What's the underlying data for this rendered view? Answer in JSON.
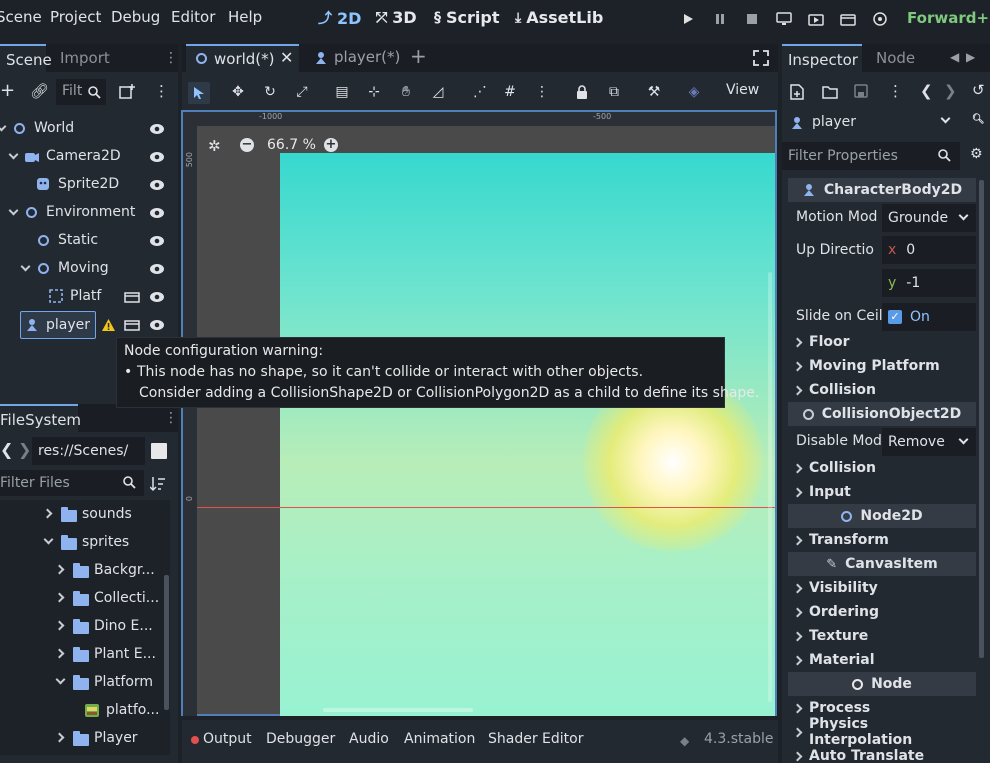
{
  "menu": [
    "Scene",
    "Project",
    "Debug",
    "Editor",
    "Help"
  ],
  "workspaces": [
    "2D",
    "3D",
    "Script",
    "AssetLib"
  ],
  "renderer": "Forward+",
  "scene_dock": {
    "tabs": [
      "Scene",
      "Import"
    ],
    "filter_placeholder": "Filt",
    "tree": [
      {
        "name": "World"
      },
      {
        "name": "Camera2D"
      },
      {
        "name": "Sprite2D"
      },
      {
        "name": "Environment"
      },
      {
        "name": "Static"
      },
      {
        "name": "Moving"
      },
      {
        "name": "Platf"
      },
      {
        "name": "player"
      }
    ]
  },
  "tooltip": {
    "title": "Node configuration warning:",
    "bullet": "•",
    "line1": "This node has no shape, so it can't collide or interact with other objects.",
    "line2": "Consider adding a CollisionShape2D or CollisionPolygon2D as a child to define its shape."
  },
  "filesystem": {
    "tab": "FileSystem",
    "path": "res://Scenes/",
    "filter_placeholder": "Filter Files",
    "items": [
      {
        "name": "sounds"
      },
      {
        "name": "sprites"
      },
      {
        "name": "Backgr..."
      },
      {
        "name": "Collecti..."
      },
      {
        "name": "Dino E..."
      },
      {
        "name": "Plant E..."
      },
      {
        "name": "Platform"
      },
      {
        "name": "platfo..."
      },
      {
        "name": "Player"
      }
    ]
  },
  "editor_tabs": [
    "world(*)",
    "player(*)"
  ],
  "toolbar": {
    "view": "View"
  },
  "viewport": {
    "zoom": "66.7 %",
    "ruler_h": [
      "-1000",
      "-500"
    ],
    "ruler_v": [
      "500",
      "0"
    ]
  },
  "bottom_panel": {
    "tabs": [
      "Output",
      "Debugger",
      "Audio",
      "Animation",
      "Shader Editor"
    ],
    "version": "4.3.stable"
  },
  "inspector": {
    "tabs": [
      "Inspector",
      "Node"
    ],
    "object": "player",
    "filter_placeholder": "Filter Properties",
    "class_header": "CharacterBody2D",
    "motion_mode": {
      "label": "Motion Mod",
      "value": "Grounde"
    },
    "up_direction": {
      "label": "Up Directio",
      "x_label": "x",
      "x": "0",
      "y_label": "y",
      "y": "-1"
    },
    "slide_on_ceiling": {
      "label": "Slide on Ceil",
      "value": "On"
    },
    "sections_a": [
      "Floor",
      "Moving Platform",
      "Collision"
    ],
    "collision_object_header": "CollisionObject2D",
    "disable_mode": {
      "label": "Disable Mod",
      "value": "Remove"
    },
    "sections_b": [
      "Collision",
      "Input"
    ],
    "node2d_header": "Node2D",
    "sections_c": [
      "Transform"
    ],
    "canvas_item_header": "CanvasItem",
    "sections_d": [
      "Visibility",
      "Ordering",
      "Texture",
      "Material"
    ],
    "node_header": "Node",
    "sections_e": [
      "Process",
      "Physics Interpolation",
      "Auto Translate"
    ]
  },
  "colors": {
    "accent": "#6fa7e8",
    "node_icon": "#8fb3ef",
    "warning": "#f5c518"
  }
}
